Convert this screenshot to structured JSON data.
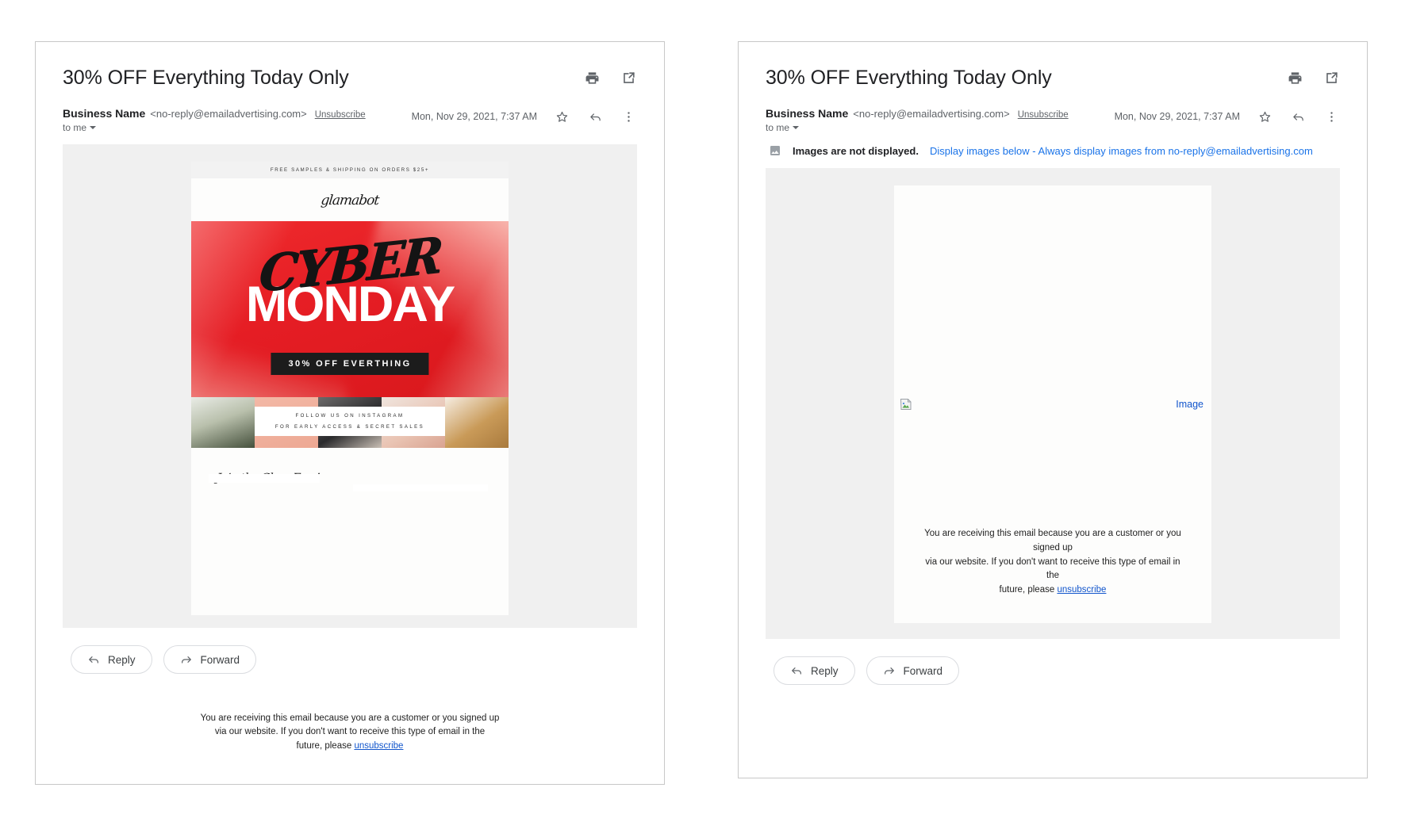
{
  "email": {
    "subject": "30% OFF Everything Today Only",
    "sender_name": "Business Name",
    "sender_email": "<no-reply@emailadvertising.com>",
    "unsubscribe_label": "Unsubscribe",
    "recipient": "to me",
    "timestamp": "Mon, Nov 29, 2021, 7:37 AM"
  },
  "toolbar": {
    "print_icon": "print-icon",
    "open_in_new_icon": "open-in-new-icon",
    "star_icon": "star-icon",
    "reply_icon": "reply-icon",
    "more_icon": "more-vert-icon"
  },
  "images_notice": {
    "icon": "broken-image-icon",
    "bold_text": "Images are not displayed.",
    "link_display": "Display images below",
    "separator": " - ",
    "link_always": "Always display images from no-reply@emailadvertising.com"
  },
  "newsletter": {
    "promo_strip": "FREE SAMPLES & SHIPPING ON ORDERS $25+",
    "brand_logo": "glamabot",
    "hero_script": "CYBER",
    "hero_headline": "MONDAY",
    "hero_badge": "30% OFF EVERTHING",
    "instagram_line1": "FOLLOW US ON INSTAGRAM",
    "instagram_line2": "FOR EARLY ACCESS & SECRET SALES",
    "join_script": "Join the Glam Fam!"
  },
  "blocked_image": {
    "broken_icon": "broken-image-placeholder-icon",
    "alt_text": "Image"
  },
  "disclaimer": {
    "line1": "You are receiving this email because you are a customer or you signed up",
    "line2": "via our website. If you don't want to receive this type of email in the",
    "line3_prefix": "future, please ",
    "unsubscribe": "unsubscribe"
  },
  "actions": {
    "reply_label": "Reply",
    "forward_label": "Forward"
  },
  "colors": {
    "link_blue": "#1a73e8",
    "hero_red": "#e51d24",
    "badge_black": "#1c1c1c",
    "body_gray": "#f0f0f0"
  }
}
